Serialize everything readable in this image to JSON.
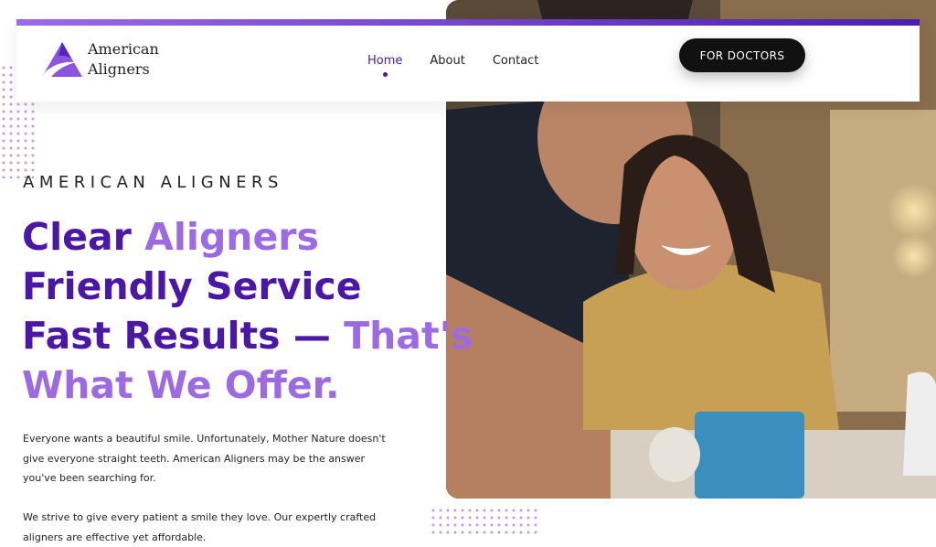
{
  "header": {
    "logo_line1": "American",
    "logo_line2": "Aligners",
    "nav": [
      "Home",
      "About",
      "Contact"
    ],
    "active_nav": "Home",
    "cta": "FOR DOCTORS",
    "accent_gradient": [
      "#9b6be8",
      "#4a1fb0"
    ]
  },
  "hero": {
    "eyebrow": "AMERICAN ALIGNERS",
    "headline": {
      "line1_dark": "Clear",
      "line1_light": "Aligners",
      "line2": "Friendly Service",
      "line3_dark": "Fast Results —",
      "line3_light": "That's",
      "line4": "What We Offer."
    },
    "paragraph1": "Everyone wants a beautiful smile. Unfortunately, Mother Nature doesn't give everyone straight teeth. American Aligners may be the answer you've been searching for.",
    "paragraph2": "We strive to give every patient a smile they love. Our expertly crafted aligners are effective yet affordable.",
    "image_alt": "smiling couple hugging in a cafe"
  },
  "colors": {
    "primary": "#4a17a6",
    "secondary": "#9c6be3",
    "button": "#111111"
  }
}
